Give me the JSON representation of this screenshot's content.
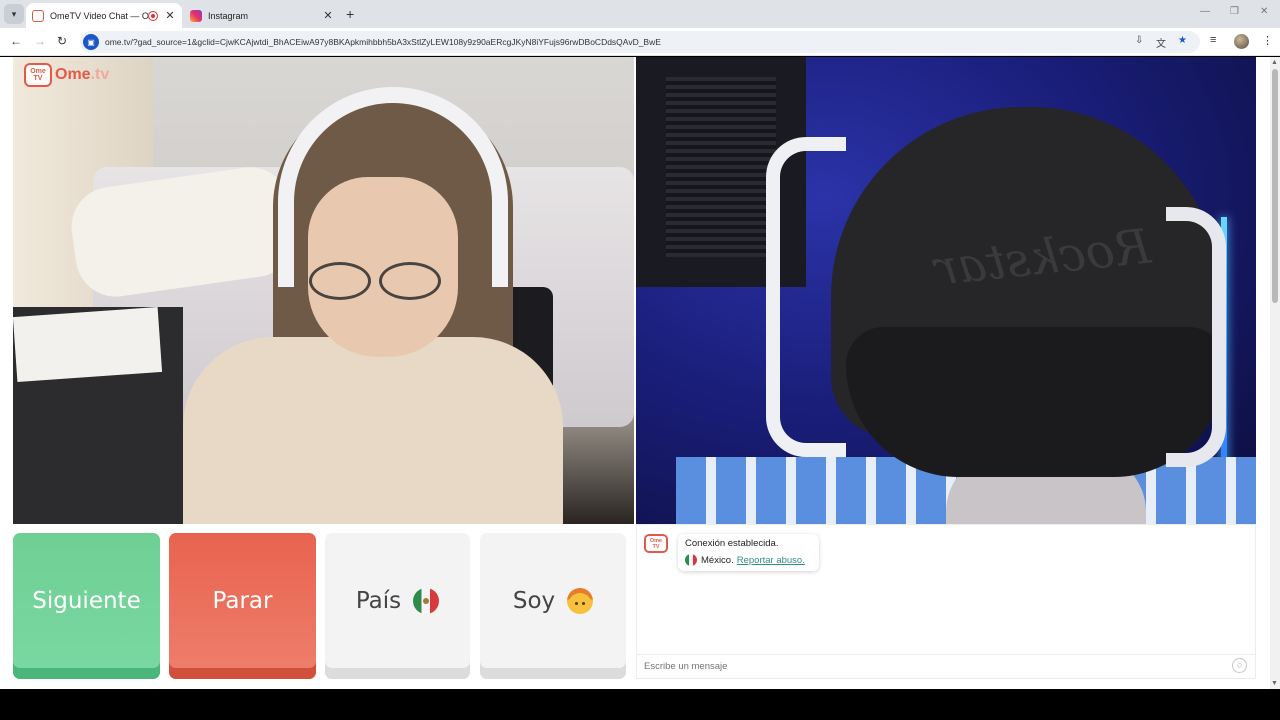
{
  "browser": {
    "tabs": [
      {
        "title": "OmeTV Video Chat — Ome",
        "close": "✕"
      },
      {
        "title": "Instagram",
        "close": "✕"
      }
    ],
    "new_tab": "+",
    "url": "ome.tv/?gad_source=1&gclid=CjwKCAjwtdi_BhACEiwA97y8BKApkmihbbh5bA3xStlZyLEW108y9z90aERcgJKyN8iYFujs96rwDBoCDdsQAvD_BwE"
  },
  "logo": {
    "tv_text": "Ome TV",
    "name": "Ome",
    "tld": ".tv"
  },
  "controls": {
    "next_label": "Siguiente",
    "stop_label": "Parar",
    "country_label": "País",
    "gender_label": "Soy"
  },
  "chat": {
    "status": "Conexión establecida.",
    "country": "México.",
    "report_link": "Reportar abuso.",
    "input_placeholder": "Escribe un mensaje"
  },
  "colors": {
    "next": "#6fcf93",
    "stop": "#e8634f",
    "brand": "#e35a4b",
    "link": "#2f8e8a"
  },
  "icons": [
    "tab-search-icon",
    "back-icon",
    "forward-icon",
    "reload-icon",
    "site-info-icon",
    "install-icon",
    "translate-icon",
    "star-icon",
    "media-icon",
    "menu-icon",
    "mexico-flag-icon",
    "boy-emoji-icon",
    "emoji-icon"
  ]
}
